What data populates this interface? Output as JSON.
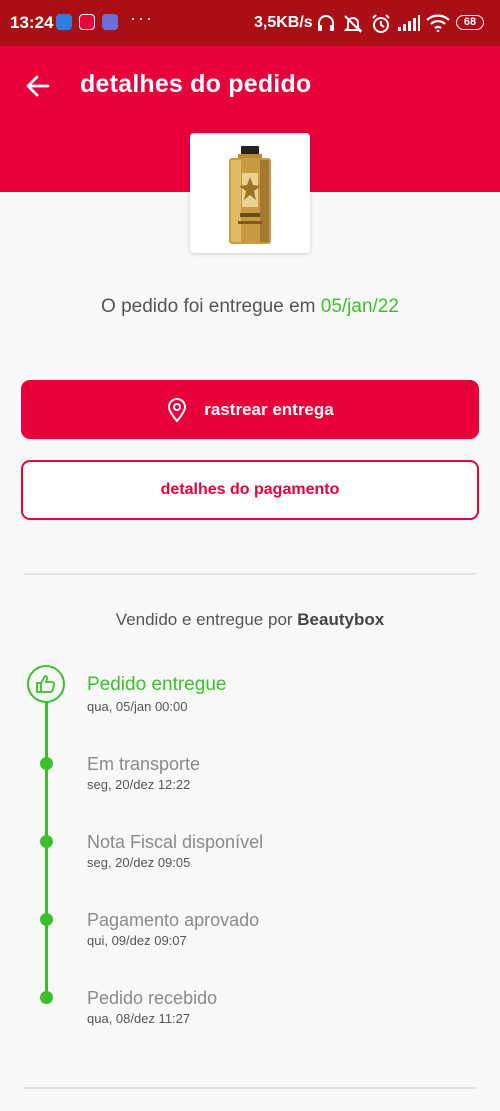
{
  "status_bar": {
    "time": "13:24",
    "dots": "···",
    "net_speed": "3,5KB/s",
    "battery": "68"
  },
  "header": {
    "title": "detalhes do pedido"
  },
  "order": {
    "delivered_prefix": "O pedido foi entregue em ",
    "delivered_date": "05/jan/22"
  },
  "actions": {
    "track_label": "rastrear entrega",
    "payment_label": "detalhes do pagamento"
  },
  "seller": {
    "prefix": "Vendido e entregue por ",
    "name": "Beautybox"
  },
  "timeline": [
    {
      "title": "Pedido entregue",
      "date": "qua, 05/jan 00:00"
    },
    {
      "title": "Em transporte",
      "date": "seg, 20/dez 12:22"
    },
    {
      "title": "Nota Fiscal disponível",
      "date": "seg, 20/dez 09:05"
    },
    {
      "title": "Pagamento aprovado",
      "date": "qui, 09/dez 09:07"
    },
    {
      "title": "Pedido recebido",
      "date": "qua, 08/dez 11:27"
    }
  ],
  "colors": {
    "brand_red": "#e8003a",
    "status_bar": "#a90f14",
    "success_green": "#3cbf2d"
  }
}
